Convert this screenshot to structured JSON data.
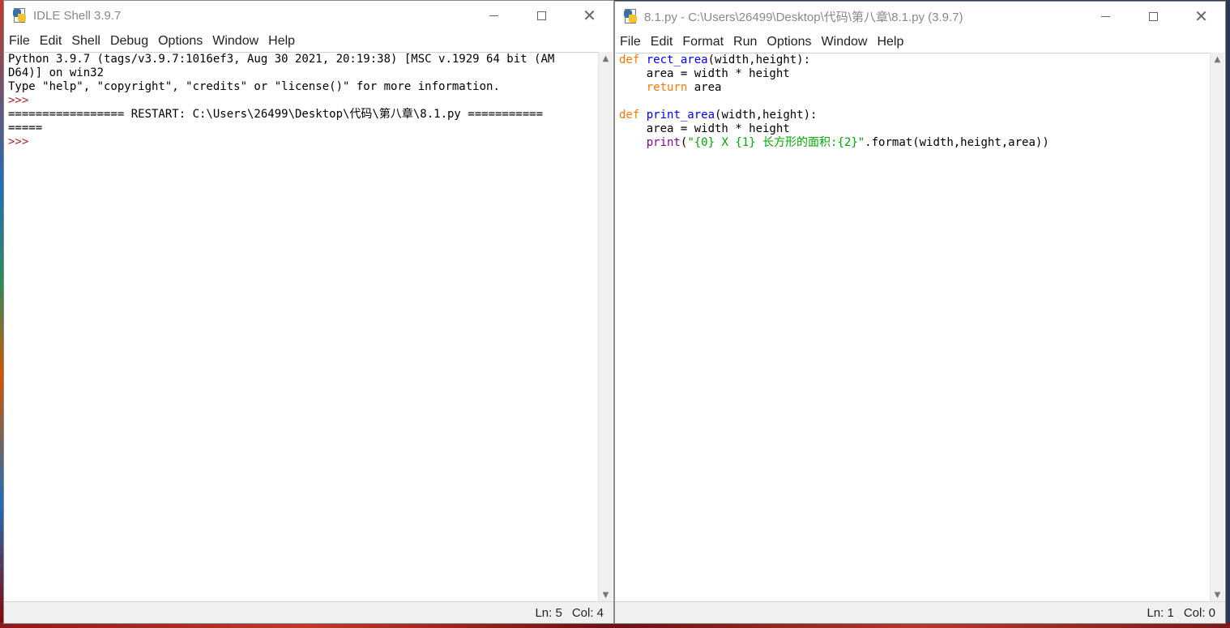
{
  "shell": {
    "title": "IDLE Shell 3.9.7",
    "menu": [
      "File",
      "Edit",
      "Shell",
      "Debug",
      "Options",
      "Window",
      "Help"
    ],
    "lines": [
      "Python 3.9.7 (tags/v3.9.7:1016ef3, Aug 30 2021, 20:19:38) [MSC v.1929 64 bit (AM",
      "D64)] on win32",
      "Type \"help\", \"copyright\", \"credits\" or \"license()\" for more information.",
      ">>> ",
      "================= RESTART: C:\\Users\\26499\\Desktop\\代码\\第八章\\8.1.py ===========",
      "=====",
      ">>> "
    ],
    "status_ln": "Ln: 5",
    "status_col": "Col: 4"
  },
  "editor": {
    "title": "8.1.py - C:\\Users\\26499\\Desktop\\代码\\第八章\\8.1.py (3.9.7)",
    "menu": [
      "File",
      "Edit",
      "Format",
      "Run",
      "Options",
      "Window",
      "Help"
    ],
    "code": {
      "l1_kw": "def",
      "l1_name": "rect_area",
      "l1_rest": "(width,height):",
      "l2": "    area = width * height",
      "l3_indent": "    ",
      "l3_kw": "return",
      "l3_rest": " area",
      "l5_kw": "def",
      "l5_name": "print_area",
      "l5_rest": "(width,height):",
      "l6": "    area = width * height",
      "l7_indent": "    ",
      "l7_builtin": "print",
      "l7_open": "(",
      "l7_str": "\"{0} X {1} 长方形的面积:{2}\"",
      "l7_rest": ".format(width,height,area))"
    },
    "status_ln": "Ln: 1",
    "status_col": "Col: 0"
  },
  "colors": {
    "keyword": "#ff7700",
    "definition": "#0000ff",
    "builtin": "#900090",
    "string": "#00aa00",
    "prompt": "#b22222"
  }
}
